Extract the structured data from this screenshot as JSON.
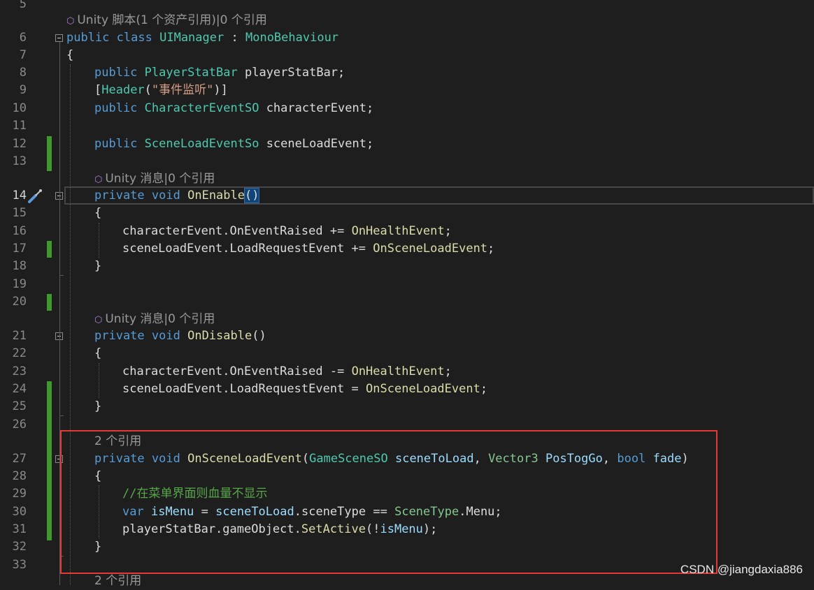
{
  "editor": {
    "lines": [
      {
        "num": "5"
      },
      {
        "lens": "Unity 脚本(1 个资产引用)|0 个引用"
      },
      {
        "num": "6"
      },
      {
        "num": "7"
      },
      {
        "num": "8"
      },
      {
        "num": "9"
      },
      {
        "num": "10"
      },
      {
        "num": "11"
      },
      {
        "num": "12"
      },
      {
        "num": "13"
      },
      {
        "lens": "Unity 消息|0 个引用"
      },
      {
        "num": "14"
      },
      {
        "num": "15"
      },
      {
        "num": "16"
      },
      {
        "num": "17"
      },
      {
        "num": "18"
      },
      {
        "num": "19"
      },
      {
        "num": "20"
      },
      {
        "lens": "Unity 消息|0 个引用"
      },
      {
        "num": "21"
      },
      {
        "num": "22"
      },
      {
        "num": "23"
      },
      {
        "num": "24"
      },
      {
        "num": "25"
      },
      {
        "num": "26"
      },
      {
        "lens": "2 个引用"
      },
      {
        "num": "27"
      },
      {
        "num": "28"
      },
      {
        "num": "29"
      },
      {
        "num": "30"
      },
      {
        "num": "31"
      },
      {
        "num": "32"
      },
      {
        "num": "33"
      },
      {
        "lens": "2 个引用"
      }
    ],
    "code": {
      "l6": {
        "kw1": "public",
        "kw2": "class",
        "name": "UIManager",
        "colon": ":",
        "base": "MonoBehaviour"
      },
      "l7": "{",
      "l8": {
        "kw": "public",
        "type": "PlayerStatBar",
        "rest": "playerStatBar;"
      },
      "l9": {
        "open": "[",
        "attr": "Header",
        "lp": "(",
        "str": "\"事件监听\"",
        "rp": ")]"
      },
      "l10": {
        "kw": "public",
        "type": "CharacterEventSO",
        "rest": "characterEvent;"
      },
      "l12": {
        "kw": "public",
        "type": "SceneLoadEventSo",
        "rest": "sceneLoadEvent;"
      },
      "l14": {
        "kw1": "private",
        "kw2": "void",
        "fn": "OnEnable",
        "parens": "()"
      },
      "l15": "{",
      "l16": {
        "obj": "characterEvent.",
        "member": "OnEventRaised",
        "op": "+=",
        "handler": "OnHealthEvent",
        "end": ";"
      },
      "l17": {
        "obj": "sceneLoadEvent.",
        "member": "LoadRequestEvent",
        "op": "+=",
        "handler": "OnSceneLoadEvent",
        "end": ";"
      },
      "l18": "}",
      "l21": {
        "kw1": "private",
        "kw2": "void",
        "fn": "OnDisable",
        "parens": "()"
      },
      "l22": "{",
      "l23": {
        "obj": "characterEvent.",
        "member": "OnEventRaised",
        "op": "-=",
        "handler": "OnHealthEvent",
        "end": ";"
      },
      "l24": {
        "obj": "sceneLoadEvent.",
        "member": "LoadRequestEvent",
        "op": "=",
        "handler": "OnSceneLoadEvent",
        "end": ";"
      },
      "l25": "}",
      "l27": {
        "kw1": "private",
        "kw2": "void",
        "fn": "OnSceneLoadEvent",
        "lp": "(",
        "t1": "GameSceneSO",
        "p1": "sceneToLoad",
        "c1": ",",
        "t2": "Vector3",
        "p2": "PosTogGo",
        "c2": ",",
        "t3": "bool",
        "p3": "fade",
        "rp": ")"
      },
      "l28": "{",
      "l29": "//在菜单界面则血量不显示",
      "l30": {
        "kw": "var",
        "v": "isMenu",
        "eq": "=",
        "a": "sceneToLoad",
        "dot1": ".",
        "b": "sceneType",
        "eqeq": "==",
        "c": "SceneType",
        "dot2": ".",
        "d": "Menu;"
      },
      "l31": {
        "a": "playerStatBar.gameObject.",
        "fn": "SetActive",
        "lp": "(!",
        "v": "isMenu",
        "rp": ");"
      },
      "l32": "}"
    },
    "current_line": "14"
  },
  "watermark": "CSDN @jiangdaxia886",
  "colors": {
    "background": "#1e1e1e",
    "keyword": "#569cd6",
    "type": "#4ec9b0",
    "method": "#dcdcaa",
    "comment": "#57a64a",
    "change_bar": "#3e9a2c",
    "highlight_box": "#e53935"
  }
}
